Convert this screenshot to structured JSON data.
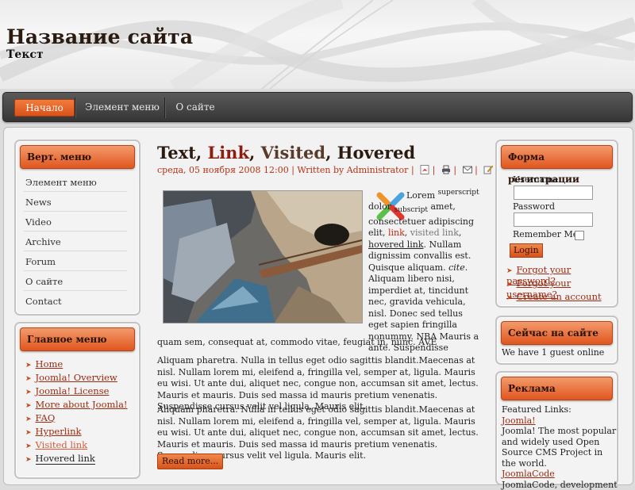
{
  "header": {
    "title": "Название сайта",
    "subtitle": "Текст"
  },
  "topnav": {
    "items": [
      "Начало",
      "Элемент меню",
      "О сайте"
    ]
  },
  "vert_menu": {
    "title": "Верт. меню",
    "items": [
      "Элемент меню",
      "News",
      "Video",
      "Archive",
      "Forum",
      "О сайте",
      "Contact"
    ]
  },
  "main_menu": {
    "title": "Главное меню",
    "items": [
      "Home",
      "Joomla! Overview",
      "Joomla! License",
      "More about Joomla!",
      "FAQ",
      "Hyperlink",
      "Visited link",
      "Hovered link"
    ]
  },
  "article": {
    "title_parts": [
      "Text",
      ", ",
      "Link",
      ", ",
      "Visited",
      ", ",
      "Hovered"
    ],
    "date": "среда, 05 ноября 2008 12:00",
    "written_by": "| Written by",
    "author": "Administrator",
    "sep": "|",
    "p1_parts": [
      "Lorem",
      "superscript",
      "dolor",
      "subscript",
      "amet, consectetuer adipiscing elit,",
      "link",
      ", ",
      "visited link",
      ", ",
      "hovered link",
      ". Nullam dignissim convallis est. Quisque aliquam.",
      "cite",
      ". Aliquam libero nisi, imperdiet at, tincidunt nec, gravida vehicula, nisl. Donec sed tellus eget sapien fringilla nonummy. NBA Mauris a ante. Suspendisse"
    ],
    "p1_rest": "quam sem, consequat at, commodo vitae, feugiat in, nunc. AVE",
    "p2": "Aliquam pharetra. Nulla in tellus eget odio sagittis blandit.Maecenas at nisl. Nullam lorem mi, eleifend a, fringilla vel, semper at, ligula. Mauris eu wisi. Ut ante dui, aliquet nec, congue non, accumsan sit amet, lectus. Mauris et mauris. Duis sed massa id mauris pretium venenatis. Suspendisse cursus velit vel ligula. Mauris elit.",
    "p3": "Aliquam pharetra. Nulla in tellus eget odio sagittis blandit.Maecenas at nisl. Nullam lorem mi, eleifend a, fringilla vel, semper at, ligula. Mauris eu wisi. Ut ante dui, aliquet nec, congue non, accumsan sit amet, lectus. Mauris et mauris. Duis sed massa id mauris pretium venenatis. Suspendisse cursus velit vel ligula. Mauris elit.",
    "read_more": "Read more..."
  },
  "login": {
    "title": "Форма регистрации",
    "username_label": "Username",
    "password_label": "Password",
    "remember_label": "Remember Me",
    "button": "Login",
    "links": [
      "Forgot your password?",
      "Forgot your username?",
      "Create an account"
    ]
  },
  "online": {
    "title": "Сейчас на сайте",
    "text": "We have 1 guest online"
  },
  "ads": {
    "title": "Реклама",
    "featured": "Featured Links:",
    "link1": "Joomla!",
    "text1": "Joomla! The most popular and widely used Open Source CMS Project in the world.",
    "link2": "JoomlaCode",
    "text2": "JoomlaCode, development"
  },
  "colors": {
    "accent": "#e0561f",
    "link": "#9b2a10",
    "nav_bg": "#3d3d3d"
  }
}
